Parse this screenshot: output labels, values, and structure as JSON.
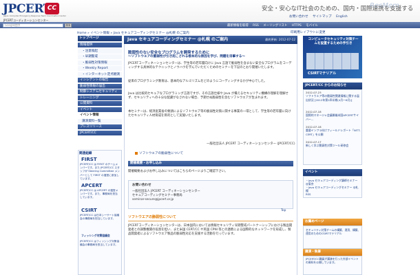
{
  "header": {
    "logo_word": "JPCERT",
    "logo_cc": "CC",
    "logo_sub": "Japan Computer Emergency Response Team Coordination Center",
    "logo_ja": "JPCERTコーディネーションセンター",
    "tagline": "安全・安心なIT社会のための、国内・国際連携を支援する",
    "links": [
      "お問い合わせ",
      "サイトマップ",
      "English"
    ],
    "watermark": "ResMem"
  },
  "toolbar": {
    "search_placeholder": "Google提供",
    "search_button": "検索",
    "links": [
      "最新情報を取得",
      "RSS",
      "メーリングリスト",
      "HTTPS",
      "モバイル"
    ]
  },
  "breadcrumb": "Home » イベント情報 » Java セキュアコーディングセミナー @札幌 のご案内",
  "page_links": "印刷用レイアウトに変更",
  "sidebar": {
    "top": "トップページ",
    "items": [
      {
        "label": "情報提供",
        "kind": "cat"
      },
      {
        "label": "・注意喚起",
        "kind": "sub"
      },
      {
        "label": "・早期警戒",
        "kind": "sub"
      },
      {
        "label": "・脆弱性対策情報",
        "kind": "sub"
      },
      {
        "label": "・Weekly Report",
        "kind": "sub"
      },
      {
        "label": "・インターネット定点観測",
        "kind": "sub"
      },
      {
        "label": "インシデントの報告",
        "kind": "cat"
      },
      {
        "label": "脆弱性情報の届出",
        "kind": "cat"
      },
      {
        "label": "制御システムセキュリティ",
        "kind": "cat"
      },
      {
        "label": "トレーニング",
        "kind": "cat"
      },
      {
        "label": "公開資料",
        "kind": "cat"
      },
      {
        "label": "イベント",
        "kind": "cat"
      },
      {
        "label": "イベント情報",
        "kind": "active"
      },
      {
        "label": "講演資料一覧",
        "kind": "sub"
      },
      {
        "label": "プレスリリース",
        "kind": "cat"
      },
      {
        "label": "JPCERT/CC",
        "kind": "cat"
      }
    ],
    "related_title": "関連組織",
    "related": [
      {
        "logo": "FIRST",
        "text": "JPCERT/CC は FIRST のチームメンバーです。また JPCERT/CC スタッフが Steering Committee メンバーとして FIRST の運営に参加しています。"
      },
      {
        "logo": "APCERT",
        "text": "JPCERT/CC は APCERT の運営メンバーです。また、事務局を担当しています。"
      },
      {
        "logo": "CSIRT",
        "text": "JPCERT/CC は日本シーサート協議会の事務局を担当しています。"
      },
      {
        "logo": "フィッシング対策協議会",
        "text": "JPCERT/CC はフィッシング対策協議会の事務局を担当しています。"
      }
    ]
  },
  "main": {
    "title": "Java セキュアコーディングセミナー @札幌 のご案内",
    "date": "最終更新: 2012-07-12",
    "heading": "脆弱性のない安全なプログラムを開発するために",
    "subheading": "～ソフトウエアの脆弱性が引き起こされる根本的な原因を学び、問題を目撃する～",
    "paragraphs": [
      "JPCERTコーディネーションセンターは、学生等の若年層向けに Java 言語で脆弱性を含まない安全なプログラムをコーディングする具体的なテクニックとノウハウを学んでいただくためのセミナーを下記のとおり開催いたします。",
      "従来のプログラミング教育は、基本的なアルゴリズムをどのようにコーディングするかが中心でした。",
      "Java は比較的セキュアなプログラミング言語ですが、その言語仕様や Java が備えるセキュリティ機構の理解を理解せず、セキュリティへの十分な配慮がなされない場合、予期せぬ脆弱性を含むソフトウエアが生まれます。",
      "本セミナーは、経済産業省の要請によるソフトウエア等の脆弱性対策に関する事業の一環として、学生等の若年層に向けたセキュリティ人材育成を目的として実施いたします。"
    ],
    "signature": "一般社団法人 JPCERT コーディネーションセンター (JPCERT/CC)",
    "sw_link": "ソフトウエアの脆弱性について",
    "section_bar": "開催概要・お申し込み",
    "apply_text": "開催概要およびお申し込みについてはこちらのページよりご確認下さい。",
    "inquiry_title": "お問い合わせ",
    "inquiry_lines": [
      "一般社団法人 JPCERT コーディネーションセンター",
      "セキュアコーディングセミナー事務局",
      "seminar-secure@jpcert.or.jp"
    ],
    "top_link": "Top",
    "about_title": "ソフトウエアの脆弱性について",
    "about_para": "JPCERTコーディネーションセンターは、日本国内においては情報セキュリティ早期警戒パートナーシップにおける製品開発者との調整機関の役割を担い、また米国 CERT/CC や英国 CPNI 等との連携による国際的なネットワークを形成し、製品開発者によるソフトウエア製品の脆弱性対応を支援する活動を行っています。"
  },
  "right": {
    "ad_text": "コンピュータセキュリティ対策チームを設置するための手引き",
    "ad_csirt": "CSIRTマテリアル",
    "news_head": "JPCERT/CC からのお知らせ",
    "news": [
      {
        "date": "2012-07-23",
        "text": "ソフトウエア等の脆弱性関連情報に関する届出状況 [2012年第2四半期(4月〜6月)]"
      },
      {
        "date": "2012-07-18",
        "text": "国際的マネージャ会議開催米国APCERTサイバー..."
      },
      {
        "date": "2012-07-18",
        "text": "重要インフラ向けフィールドレポート「NITT-CERT」を公開"
      },
      {
        "date": "2012-07-17",
        "text": "新しく学ぶ脆弱性対策ツール研修会"
      }
    ],
    "events_head": "イベント",
    "events": [
      "・Java セキュアコーディング講師セミナー @東京",
      "・Java セキュアコーディングセミナー @札幌"
    ],
    "rss": "RSS",
    "rec_head": "お薦めページ",
    "rec_text": "セキュリティ対策チームの構築、運用、構築、運用のためのCSIRTマテリアル",
    "dl_head": "講演・執筆",
    "dl_text": "JPCERT/CC職員が講演を行った外部イベントの資料を公開しています。"
  }
}
